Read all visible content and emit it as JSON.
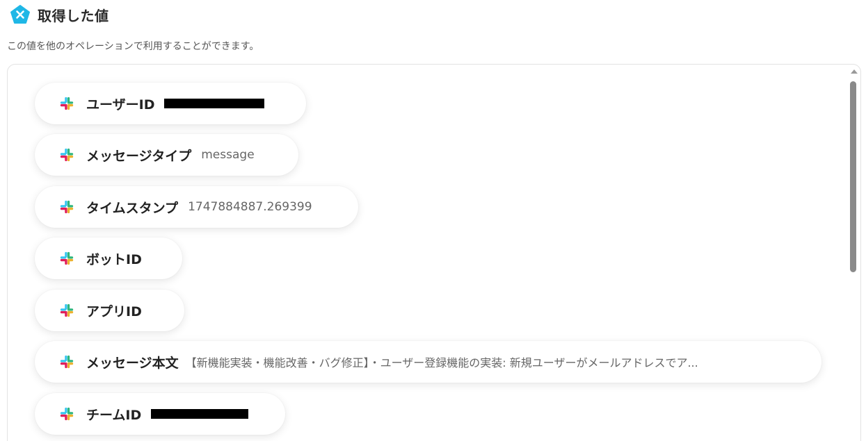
{
  "header": {
    "logo_icon": "yoom-pentagon-logo",
    "title": "取得した値",
    "subtitle": "この値を他のオペレーションで利用することができます。"
  },
  "colors": {
    "logo": "#1fb7e6",
    "slack_blue": "#36c5f0",
    "slack_green": "#2eb67d",
    "slack_yellow": "#ecb22e",
    "slack_red": "#e01e5a"
  },
  "fields": [
    {
      "icon": "slack-icon",
      "label": "ユーザーID",
      "value": "",
      "redacted": true
    },
    {
      "icon": "slack-icon",
      "label": "メッセージタイプ",
      "value": "message",
      "redacted": false
    },
    {
      "icon": "slack-icon",
      "label": "タイムスタンプ",
      "value": "1747884887.269399",
      "redacted": false
    },
    {
      "icon": "slack-icon",
      "label": "ボットID",
      "value": "",
      "redacted": false
    },
    {
      "icon": "slack-icon",
      "label": "アプリID",
      "value": "",
      "redacted": false
    },
    {
      "icon": "slack-icon",
      "label": "メッセージ本文",
      "value": "【新機能実装・機能改善・バグ修正】・ユーザー登録機能の実装: 新規ユーザーがメールアドレスでア...",
      "redacted": false
    },
    {
      "icon": "slack-icon",
      "label": "チームID",
      "value": "",
      "redacted": true
    }
  ]
}
